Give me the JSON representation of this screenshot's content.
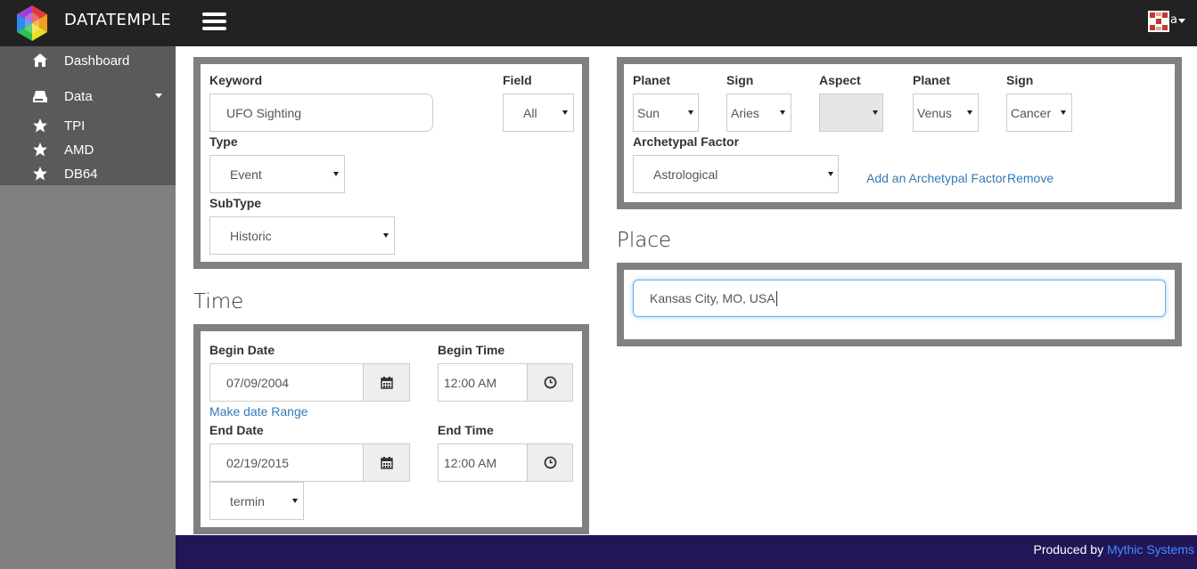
{
  "app": {
    "brand": "DATATEMPLE",
    "user_initial": "a"
  },
  "sidebar": {
    "items": [
      {
        "label": "Dashboard",
        "icon": "home-icon"
      },
      {
        "label": "Data",
        "icon": "hdd-icon"
      },
      {
        "label": "TPI",
        "icon": "star-icon"
      },
      {
        "label": "AMD",
        "icon": "star-icon"
      },
      {
        "label": "DB64",
        "icon": "star-icon"
      }
    ]
  },
  "search": {
    "keyword_label": "Keyword",
    "keyword_value": "UFO Sighting",
    "field_label": "Field",
    "field_value": "All",
    "type_label": "Type",
    "type_value": "Event",
    "subtype_label": "SubType",
    "subtype_value": "Historic"
  },
  "astro": {
    "planet1_label": "Planet",
    "planet1_value": "Sun",
    "sign1_label": "Sign",
    "sign1_value": "Aries",
    "aspect_label": "Aspect",
    "aspect_value": "",
    "planet2_label": "Planet",
    "planet2_value": "Venus",
    "sign2_label": "Sign",
    "sign2_value": "Cancer",
    "archetypal_label": "Archetypal Factor",
    "archetypal_value": "Astrological",
    "add_link": "Add an Archetypal Factor",
    "remove_link": "Remove"
  },
  "time": {
    "heading": "Time",
    "begin_date_label": "Begin Date",
    "begin_date_value": "07/09/2004",
    "begin_time_label": "Begin Time",
    "begin_time_value": "12:00 AM",
    "range_link": "Make date Range",
    "end_date_label": "End Date",
    "end_date_value": "02/19/2015",
    "end_time_label": "End Time",
    "end_time_value": "12:00 AM",
    "mode_value": "termin"
  },
  "place": {
    "heading": "Place",
    "value": "Kansas City, MO, USA"
  },
  "footer": {
    "produced_by": "Produced by ",
    "company": "Mythic Systems"
  },
  "colors": {
    "topbar": "#222222",
    "sidebar": "#5a5a5a",
    "panel_border": "#808080",
    "footer": "#221558",
    "link": "#337ab7"
  }
}
